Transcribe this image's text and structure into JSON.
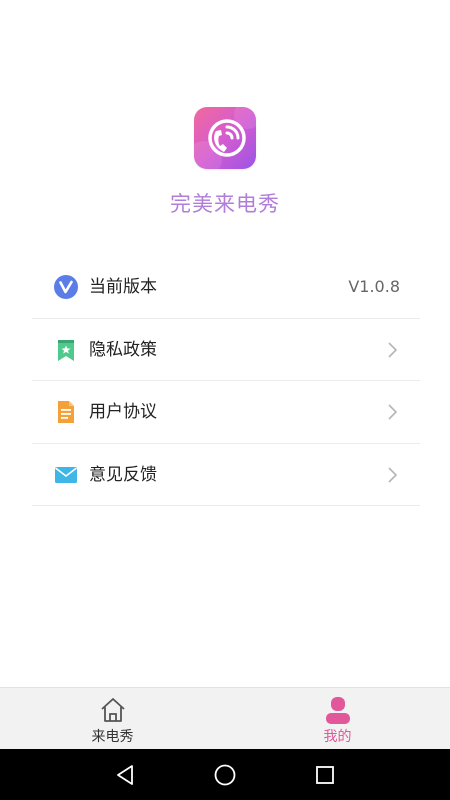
{
  "app": {
    "name": "完美来电秀",
    "logo_icon": "phone-call-icon"
  },
  "menu": {
    "items": [
      {
        "label": "当前版本",
        "value": "V1.0.8",
        "icon": "v-badge-icon",
        "icon_color": "#5b7de8"
      },
      {
        "label": "隐私政策",
        "icon": "bookmark-star-icon",
        "icon_color": "#4fc98c"
      },
      {
        "label": "用户协议",
        "icon": "document-icon",
        "icon_color": "#f5a13a"
      },
      {
        "label": "意见反馈",
        "icon": "envelope-icon",
        "icon_color": "#3fb6e8"
      }
    ]
  },
  "tabbar": {
    "tabs": [
      {
        "label": "来电秀",
        "icon": "home-icon",
        "active": false
      },
      {
        "label": "我的",
        "icon": "user-icon",
        "active": true
      }
    ],
    "active_color": "#e2579a"
  },
  "system_nav": {
    "buttons": [
      "back-icon",
      "home-circle-icon",
      "recent-apps-icon"
    ]
  }
}
